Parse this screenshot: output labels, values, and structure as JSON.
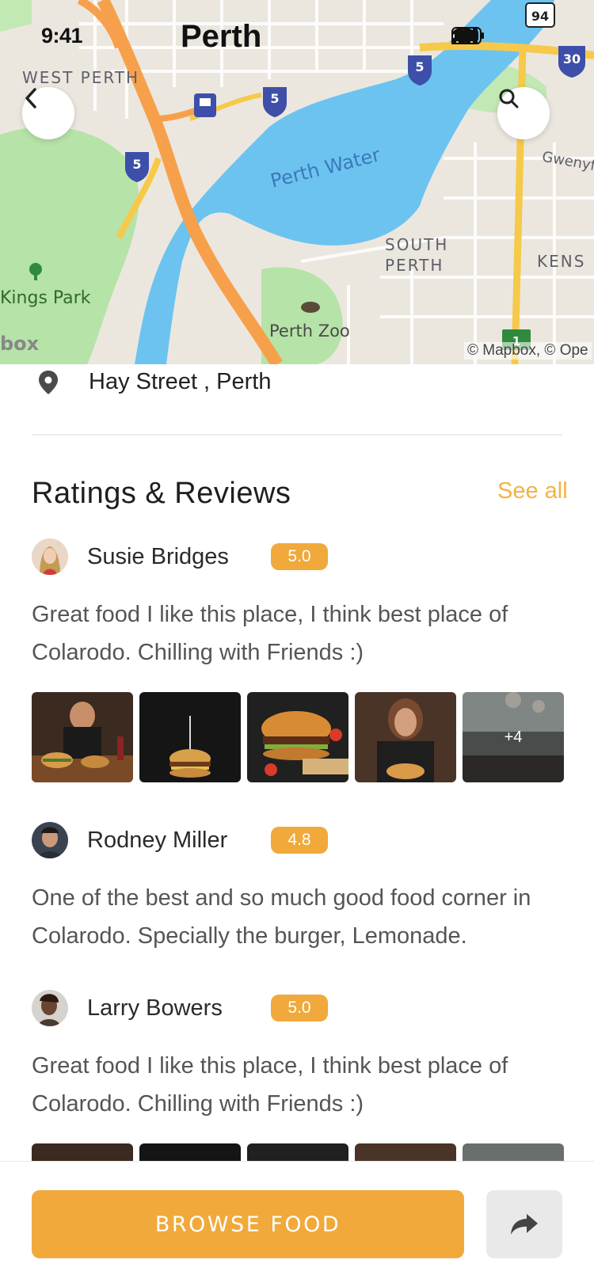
{
  "status_bar": {
    "time": "9:41"
  },
  "map": {
    "city_title": "Perth",
    "labels": {
      "west_perth": "WEST PERTH",
      "perth_water": "Perth Water",
      "south_perth": "SOUTH PERTH",
      "kings_park": "Kings Park",
      "perth_zoo": "Perth Zoo",
      "gwenyfred": "Gwenyfr",
      "kens": "KENS",
      "mapbox_logo": "box"
    },
    "route_shields": [
      "5",
      "5",
      "5",
      "30",
      "94",
      "1"
    ],
    "attribution": "© Mapbox, © Ope",
    "icons": {
      "back": "chevron-left-icon",
      "search": "search-icon"
    }
  },
  "address": {
    "icon": "location-pin-icon",
    "text": "Hay Street , Perth"
  },
  "reviews_section": {
    "title": "Ratings & Reviews",
    "see_all": "See all",
    "reviews": [
      {
        "name": "Susie Bridges",
        "rating": "5.0",
        "text": "Great food I like this place, I think best place of Colarodo. Chilling with Friends :)",
        "photos_more": "+4"
      },
      {
        "name": "Rodney Miller",
        "rating": "4.8",
        "text": "One of the best and so much good food corner in Colarodo. Specially the burger, Lemonade."
      },
      {
        "name": "Larry Bowers",
        "rating": "5.0",
        "text": "Great food I like this place, I think best place of Colarodo. Chilling with Friends :)"
      }
    ]
  },
  "bottom_bar": {
    "browse_label": "BROWSE FOOD",
    "share_icon": "share-arrow-icon"
  },
  "colors": {
    "accent": "#f0a93a",
    "see_all": "#f5b342",
    "water": "#6cc3f0",
    "park": "#b6e3a8",
    "highway": "#f7a04b"
  }
}
